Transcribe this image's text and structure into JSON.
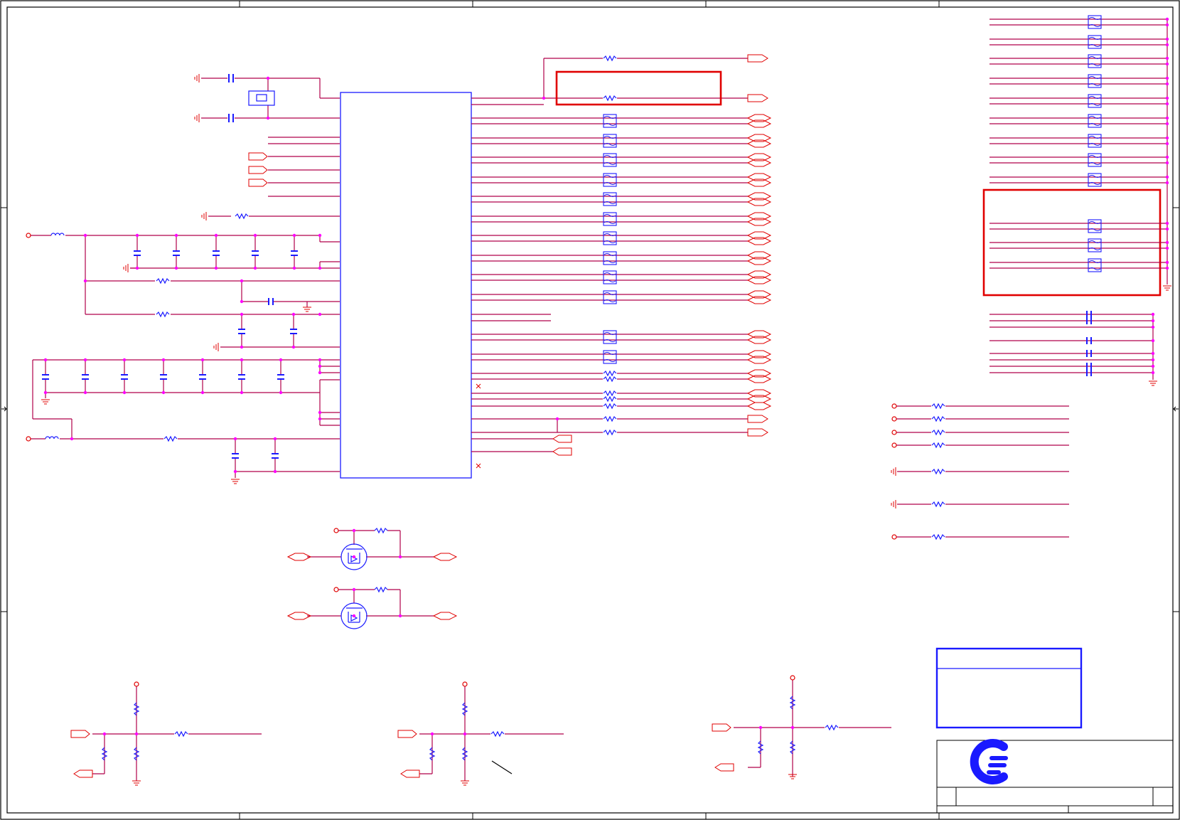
{
  "schematic": {
    "colors": {
      "wire": "#b0004a",
      "component": "#1a1aff",
      "net_port": "#e00000",
      "junction": "#ff00ff",
      "highlight": "#e00000",
      "border": "#000000"
    },
    "component_kinds": [
      "ic",
      "crystal",
      "capacitor",
      "resistor",
      "inductor",
      "ferrite-bead",
      "mosfet",
      "net-port",
      "power-port",
      "ground",
      "junction"
    ],
    "title_block": {
      "logo": "company-logo-icon"
    }
  }
}
